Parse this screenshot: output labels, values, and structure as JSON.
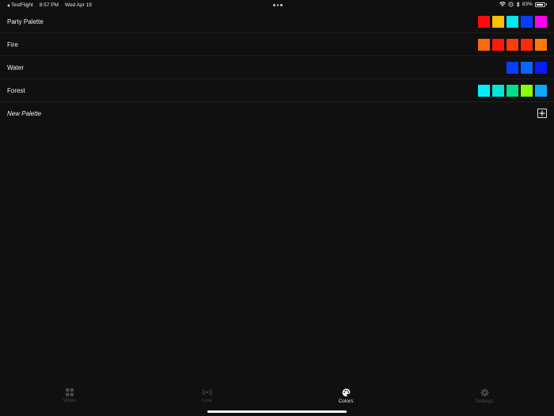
{
  "status_bar": {
    "back_app": "TestFlight",
    "time": "8:57 PM",
    "date": "Wed Apr 19",
    "battery": "83%",
    "battery_level": 0.83
  },
  "palettes": [
    {
      "name": "Party Palette",
      "colors": [
        "#ff0a0a",
        "#ffbf00",
        "#00e5ee",
        "#0a3bff",
        "#ff00ee"
      ]
    },
    {
      "name": "Fire",
      "colors": [
        "#ff6a0a",
        "#ff1a0a",
        "#ff3b0a",
        "#ff2a0a",
        "#ff7a0a"
      ]
    },
    {
      "name": "Water",
      "colors": [
        "#0a3bff",
        "#0a66ff",
        "#0a1aff"
      ]
    },
    {
      "name": "Forest",
      "colors": [
        "#00f0ff",
        "#00e6d8",
        "#00e08a",
        "#88ff0a",
        "#0aa8ff"
      ]
    }
  ],
  "new_palette": {
    "label": "New Palette"
  },
  "tabs": [
    {
      "label": "Vibes",
      "icon": "grid-icon",
      "active": false
    },
    {
      "label": "Live",
      "icon": "broadcast-icon",
      "active": false
    },
    {
      "label": "Colors",
      "icon": "palette-icon",
      "active": true
    },
    {
      "label": "Settings",
      "icon": "gear-icon",
      "active": false
    }
  ]
}
